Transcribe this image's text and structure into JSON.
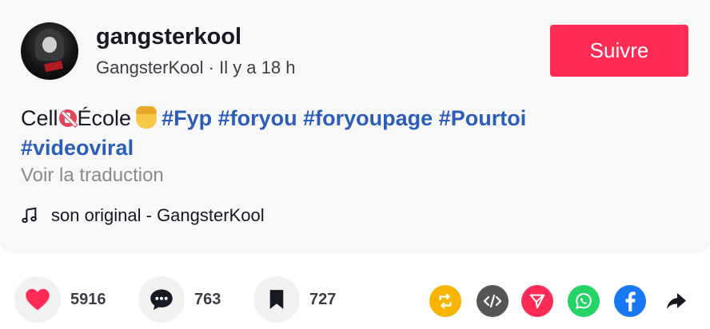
{
  "post": {
    "username": "gangsterkool",
    "display_meta": "GangsterKool · Il y a 18 h",
    "follow_label": "Suivre",
    "caption_text": "Cell",
    "caption_word2": "École",
    "hashtags_line1": [
      "#Fyp",
      "#foryou",
      "#foryoupage",
      "#Pourtoi"
    ],
    "hashtag_line2": "#videoviral",
    "translate_label": "Voir la traduction",
    "sound_label": "son original - GangsterKool"
  },
  "actions": {
    "likes": "5916",
    "comments": "763",
    "saves": "727"
  },
  "colors": {
    "accent": "#fe2c55",
    "hashtag": "#2b5db9",
    "repost": "#f7b500",
    "embed": "#555555",
    "send": "#fe2c55",
    "whatsapp": "#25d366",
    "facebook": "#1877f2"
  },
  "icons": [
    "music-note-icon",
    "heart-icon",
    "comment-icon",
    "bookmark-icon",
    "repost-icon",
    "embed-icon",
    "send-icon",
    "whatsapp-icon",
    "facebook-icon",
    "share-arrow-icon"
  ]
}
